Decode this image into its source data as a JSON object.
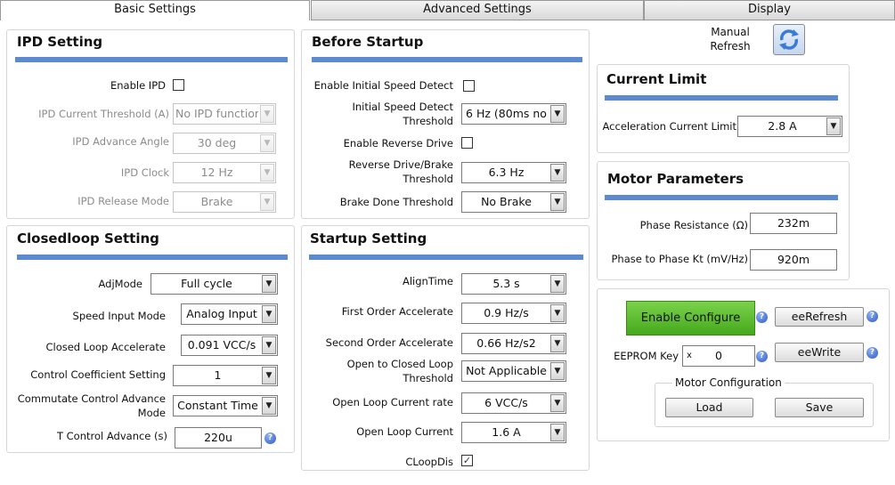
{
  "tabs": [
    "Basic Settings",
    "Advanced Settings",
    "Display"
  ],
  "manual_refresh_label": "Manual\nRefresh",
  "ipd": {
    "title": "IPD Setting",
    "enable_label": "Enable IPD",
    "enable_checked": false,
    "threshold_label": "IPD Current Threshold (A)",
    "threshold_value": "No IPD function",
    "angle_label": "IPD Advance Angle",
    "angle_value": "30 deg",
    "clock_label": "IPD Clock",
    "clock_value": "12 Hz",
    "release_label": "IPD Release Mode",
    "release_value": "Brake"
  },
  "closedloop": {
    "title": "Closedloop Setting",
    "adjmode_label": "AdjMode",
    "adjmode_value": "Full cycle",
    "speed_input_label": "Speed Input Mode",
    "speed_input_value": "Analog Input",
    "accel_label": "Closed Loop Accelerate",
    "accel_value": "0.091 VCC/s",
    "coeff_label": "Control Coefficient Setting",
    "coeff_value": "1",
    "commutate_label": "Commutate Control Advance\nMode",
    "commutate_value": "Constant Time",
    "tcontrol_label": "T Control Advance (s)",
    "tcontrol_value": "220u"
  },
  "before_startup": {
    "title": "Before Startup",
    "speed_detect_label": "Enable Initial Speed Detect",
    "speed_detect_checked": false,
    "isd_threshold_label": "Initial Speed Detect\nThreshold",
    "isd_threshold_value": "6 Hz (80ms no",
    "reverse_label": "Enable Reverse Drive",
    "reverse_checked": false,
    "reverse_threshold_label": "Reverse Drive/Brake\nThreshold",
    "reverse_threshold_value": "6.3 Hz",
    "brake_label": "Brake Done Threshold",
    "brake_value": "No Brake"
  },
  "startup": {
    "title": "Startup Setting",
    "align_label": "AlignTime",
    "align_value": "5.3 s",
    "first_label": "First Order Accelerate",
    "first_value": "0.9 Hz/s",
    "second_label": "Second Order Accelerate",
    "second_value": "0.66 Hz/s2",
    "otc_label": "Open to Closed Loop\nThreshold",
    "otc_value": "Not Applicable",
    "olcr_label": "Open Loop Current rate",
    "olcr_value": "6 VCC/s",
    "olc_label": "Open Loop Current",
    "olc_value": "1.6 A",
    "cloopdis_label": "CLoopDis",
    "cloopdis_checked": true
  },
  "current_limit": {
    "title": "Current Limit",
    "accel_label": "Acceleration Current Limit",
    "accel_value": "2.8 A"
  },
  "motor": {
    "title": "Motor Parameters",
    "phase_res_label": "Phase Resistance (Ω)",
    "phase_res_value": "232m",
    "kt_label": "Phase to Phase Kt (mV/Hz)",
    "kt_value": "920m"
  },
  "config": {
    "enable_label": "Enable Configure",
    "eerefresh_label": "eeRefresh",
    "eewrite_label": "eeWrite",
    "eeprom_key_label": "EEPROM Key",
    "eeprom_key_prefix": "x",
    "eeprom_key_value": "0",
    "motor_config_label": "Motor Configuration",
    "load_label": "Load",
    "save_label": "Save"
  },
  "help_glyph": "?",
  "dropdown_glyph": "▼",
  "check_glyph": "✓",
  "colors": {
    "section_bar": "#5b8ad0",
    "enable_configure": "#56b82a",
    "help": "#2c59c8"
  }
}
